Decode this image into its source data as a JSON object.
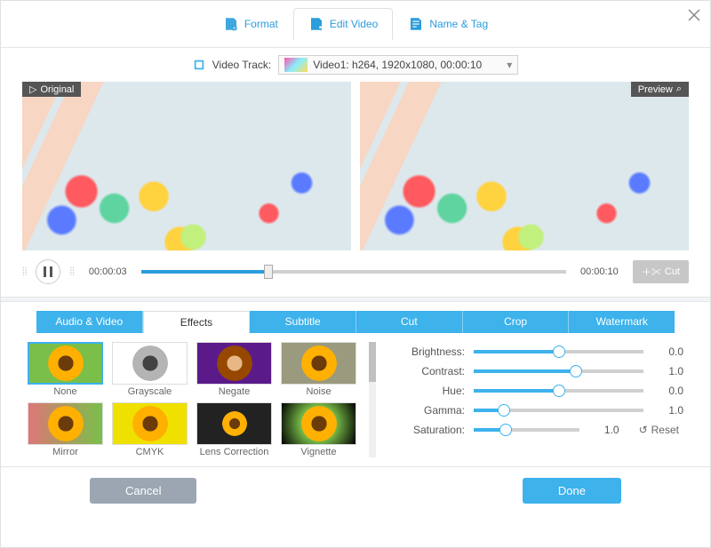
{
  "mainTabs": {
    "format": "Format",
    "edit": "Edit Video",
    "name": "Name & Tag"
  },
  "track": {
    "label": "Video Track:",
    "value": "Video1: h264, 1920x1080, 00:00:10"
  },
  "preview": {
    "original": "Original",
    "preview": "Preview"
  },
  "playback": {
    "current": "00:00:03",
    "total": "00:00:10",
    "cut": "Cut"
  },
  "effTabs": {
    "av": "Audio & Video",
    "effects": "Effects",
    "subtitle": "Subtitle",
    "cut": "Cut",
    "crop": "Crop",
    "watermark": "Watermark"
  },
  "effects": {
    "none": "None",
    "grayscale": "Grayscale",
    "negate": "Negate",
    "noise": "Noise",
    "mirror": "Mirror",
    "cmyk": "CMYK",
    "lens": "Lens Correction",
    "vignette": "Vignette"
  },
  "sliders": {
    "brightness": {
      "label": "Brightness:",
      "value": "0.0",
      "pct": 50
    },
    "contrast": {
      "label": "Contrast:",
      "value": "1.0",
      "pct": 60
    },
    "hue": {
      "label": "Hue:",
      "value": "0.0",
      "pct": 50
    },
    "gamma": {
      "label": "Gamma:",
      "value": "1.0",
      "pct": 18
    },
    "saturation": {
      "label": "Saturation:",
      "value": "1.0",
      "pct": 30
    }
  },
  "reset": "Reset",
  "footer": {
    "cancel": "Cancel",
    "done": "Done"
  }
}
